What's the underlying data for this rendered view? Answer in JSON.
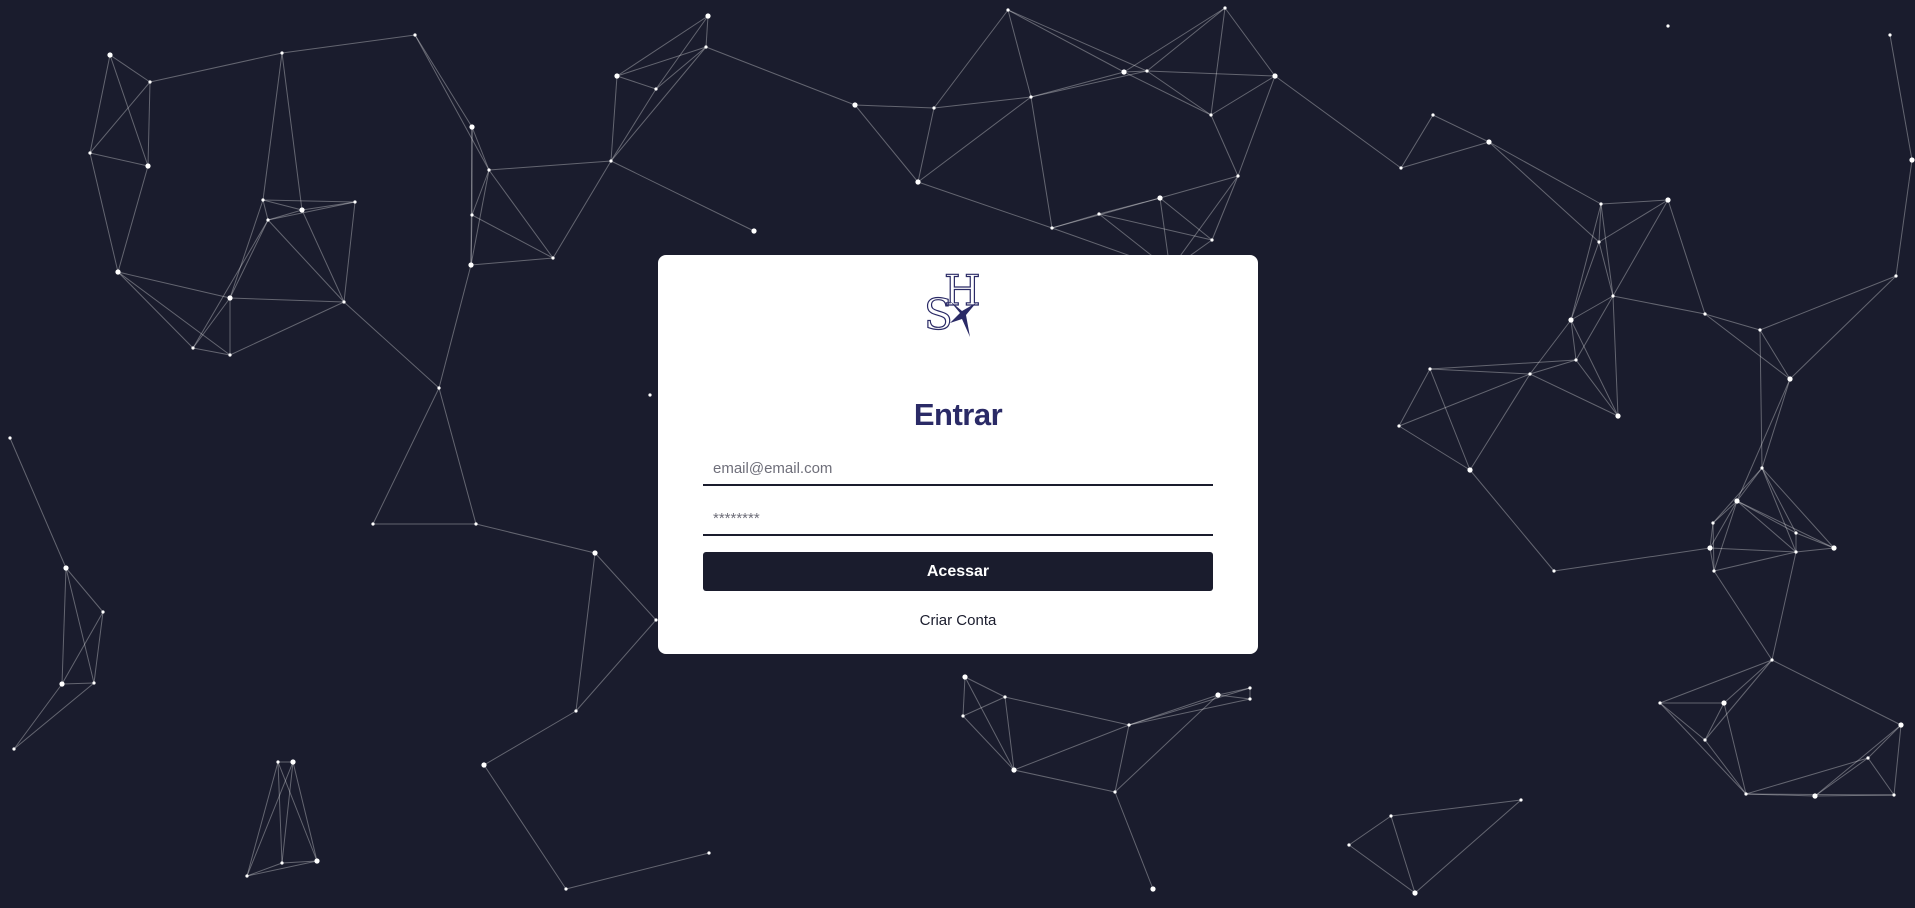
{
  "colors": {
    "background": "#1a1c2d",
    "card": "#ffffff",
    "title": "#2a2a66",
    "button": "#1a1c2d",
    "network_line": "rgba(255,255,255,0.32)",
    "network_node": "#ffffff"
  },
  "logo": {
    "name": "sh-swallow-logo"
  },
  "login": {
    "title": "Entrar",
    "email_placeholder": "email@email.com",
    "email_value": "",
    "password_placeholder": "********",
    "password_value": "",
    "submit_label": "Acessar",
    "create_account_label": "Criar Conta"
  }
}
